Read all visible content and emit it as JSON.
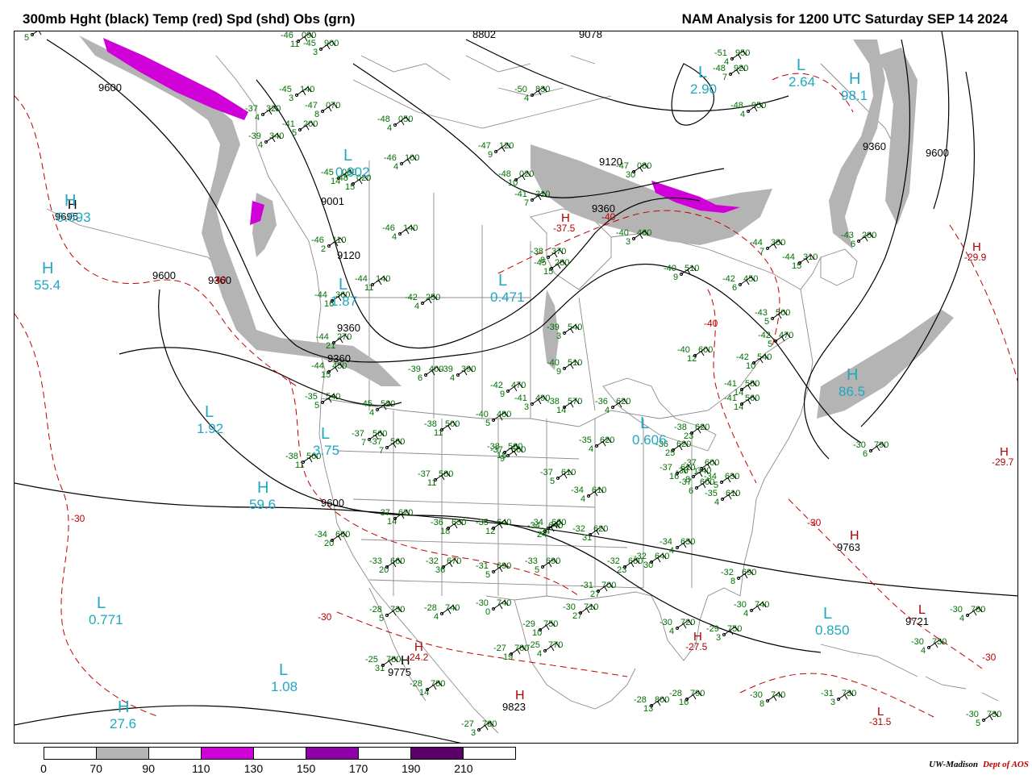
{
  "header": {
    "left_title": "300mb Hght (black) Temp (red) Spd (shd) Obs (grn)",
    "right_title": "NAM Analysis for 1200 UTC Saturday  SEP 14 2024"
  },
  "colors": {
    "height_contour": "#000000",
    "temp_contour": "#c00000",
    "obs_text": "#007000",
    "center_label": "#20a8c0",
    "temp_center": "#b00000",
    "map_lines": "#8c8c8c",
    "speed_70_90": "#b4b4b4",
    "speed_110_130": "#d000d8",
    "speed_150_170": "#9000a8",
    "speed_190_210": "#5a0068"
  },
  "height_labels": [
    "9600",
    "9360",
    "9120",
    "9600",
    "9360",
    "9600",
    "9120",
    "9360",
    "9360",
    "9600",
    "9360",
    "9078",
    "8802",
    "9001"
  ],
  "height_centers": [
    {
      "type": "H",
      "value": "9695"
    },
    {
      "type": "H",
      "value": "9775"
    },
    {
      "type": "H",
      "value": "9823"
    },
    {
      "type": "L",
      "value": "9721"
    },
    {
      "type": "H",
      "value": "9763"
    }
  ],
  "speed_centers": [
    {
      "type": "H",
      "value": "0.693"
    },
    {
      "type": "H",
      "value": "55.4"
    },
    {
      "type": "L",
      "value": "0.902"
    },
    {
      "type": "L",
      "value": "1.92"
    },
    {
      "type": "H",
      "value": "59.6"
    },
    {
      "type": "L",
      "value": "0.771"
    },
    {
      "type": "L",
      "value": "1.08"
    },
    {
      "type": "H",
      "value": "27.6"
    },
    {
      "type": "L",
      "value": "0.606"
    },
    {
      "type": "L",
      "value": "0.850"
    },
    {
      "type": "H",
      "value": "86.5"
    },
    {
      "type": "L",
      "value": "2.64"
    },
    {
      "type": "H",
      "value": "98.1"
    },
    {
      "type": "L",
      "value": "2.90"
    },
    {
      "type": "L",
      "value": "0.471"
    },
    {
      "type": "L",
      "value": "1.87"
    },
    {
      "type": "L",
      "value": "3.75"
    }
  ],
  "temp_centers": [
    {
      "type": "H",
      "value": "-37.5"
    },
    {
      "type": "H",
      "value": "-29.9"
    },
    {
      "type": "H",
      "value": "-24.2"
    },
    {
      "type": "H",
      "value": "-27.5"
    },
    {
      "type": "L",
      "value": "-31.5"
    },
    {
      "type": "H",
      "value": "-29.7"
    }
  ],
  "temp_labels": [
    "-30",
    "-30",
    "-40",
    "-40",
    "-30",
    "-30",
    "-40"
  ],
  "observations": [
    {
      "t": "-45",
      "h": "140",
      "d": "3"
    },
    {
      "t": "-47",
      "h": "070",
      "d": "8"
    },
    {
      "t": "-41",
      "h": "200",
      "d": "5"
    },
    {
      "t": "-39",
      "h": "340",
      "d": "4"
    },
    {
      "t": "-37",
      "h": "320",
      "d": "4"
    },
    {
      "t": "-48",
      "h": "050",
      "d": "4"
    },
    {
      "t": "-46",
      "h": "100",
      "d": "4"
    },
    {
      "t": "-47",
      "h": "120",
      "d": "9"
    },
    {
      "t": "-46",
      "h": "140",
      "d": "4"
    },
    {
      "t": "-41",
      "h": "310",
      "d": "7"
    },
    {
      "t": "-50",
      "h": "830",
      "d": "4"
    },
    {
      "t": "-51",
      "h": "950",
      "d": "4"
    },
    {
      "t": "-48",
      "h": "950",
      "d": "4"
    },
    {
      "t": "-43",
      "h": "280",
      "d": "6"
    },
    {
      "t": "-44",
      "h": "310",
      "d": "15"
    },
    {
      "t": "-40",
      "h": "460",
      "d": "3"
    },
    {
      "t": "-40",
      "h": "510",
      "d": "9"
    },
    {
      "t": "-42",
      "h": "450",
      "d": "6"
    },
    {
      "t": "-44",
      "h": "380",
      "d": "7"
    },
    {
      "t": "-42",
      "h": "250",
      "d": "4"
    },
    {
      "t": "-44",
      "h": "140",
      "d": "11"
    },
    {
      "t": "-38",
      "h": "370",
      "d": "8"
    },
    {
      "t": "-39",
      "h": "540",
      "d": "3"
    },
    {
      "t": "-40",
      "h": "510",
      "d": "9"
    },
    {
      "t": "-42",
      "h": "470",
      "d": "9"
    },
    {
      "t": "-41",
      "h": "490",
      "d": "3"
    },
    {
      "t": "-38",
      "h": "570",
      "d": "14"
    },
    {
      "t": "-36",
      "h": "620",
      "d": "4"
    },
    {
      "t": "-40",
      "h": "600",
      "d": "12"
    },
    {
      "t": "-38",
      "h": "620",
      "d": "23"
    },
    {
      "t": "-35",
      "h": "620",
      "d": "4"
    },
    {
      "t": "-36",
      "h": "620",
      "d": "25"
    },
    {
      "t": "-37",
      "h": "600",
      "d": "1"
    },
    {
      "t": "-34",
      "h": "630",
      "d": "5"
    },
    {
      "t": "-35",
      "h": "610",
      "d": "4"
    },
    {
      "t": "-32",
      "h": "690",
      "d": "8"
    },
    {
      "t": "-30",
      "h": "740",
      "d": "4"
    },
    {
      "t": "-29",
      "h": "750",
      "d": "3"
    },
    {
      "t": "-28",
      "h": "800",
      "d": "13"
    },
    {
      "t": "-28",
      "h": "790",
      "d": "16"
    },
    {
      "t": "-30",
      "h": "740",
      "d": "8"
    },
    {
      "t": "-31",
      "h": "730",
      "d": "3"
    },
    {
      "t": "-30",
      "h": "730",
      "d": "5"
    },
    {
      "t": "-30",
      "h": "780",
      "d": "4"
    },
    {
      "t": "-30",
      "h": "730",
      "d": "4"
    },
    {
      "t": "-30",
      "h": "790",
      "d": "6"
    },
    {
      "t": "-42",
      "h": "540",
      "d": "10"
    },
    {
      "t": "-41",
      "h": "580",
      "d": "14"
    },
    {
      "t": "-41",
      "h": "560",
      "d": "14"
    },
    {
      "t": "-42",
      "h": "470",
      "d": "5"
    },
    {
      "t": "-43",
      "h": "500",
      "d": "5"
    },
    {
      "t": "-37",
      "h": "610",
      "d": "16"
    },
    {
      "t": "-37",
      "h": "560",
      "d": "9"
    },
    {
      "t": "-38",
      "h": "580",
      "d": "18"
    },
    {
      "t": "-37",
      "h": "610",
      "d": "5"
    },
    {
      "t": "-34",
      "h": "640",
      "d": "24"
    },
    {
      "t": "-35",
      "h": "640",
      "d": "12"
    },
    {
      "t": "-34",
      "h": "660",
      "d": "24"
    },
    {
      "t": "-32",
      "h": "620",
      "d": "31"
    },
    {
      "t": "-34",
      "h": "610",
      "d": "4"
    },
    {
      "t": "-34",
      "h": "630",
      "d": "4"
    },
    {
      "t": "-32",
      "h": "640",
      "d": "30"
    },
    {
      "t": "-32",
      "h": "680",
      "d": "23"
    },
    {
      "t": "-33",
      "h": "690",
      "d": "5"
    },
    {
      "t": "-31",
      "h": "690",
      "d": "5"
    },
    {
      "t": "-32",
      "h": "670",
      "d": "36"
    },
    {
      "t": "-33",
      "h": "660",
      "d": "20"
    },
    {
      "t": "-34",
      "h": "660",
      "d": "20"
    },
    {
      "t": "-37",
      "h": "620",
      "d": "14"
    },
    {
      "t": "-36",
      "h": "630",
      "d": "18"
    },
    {
      "t": "-37",
      "h": "580",
      "d": "11"
    },
    {
      "t": "-38",
      "h": "500",
      "d": "11"
    },
    {
      "t": "-40",
      "h": "480",
      "d": "5"
    },
    {
      "t": "-37",
      "h": "560",
      "d": "7"
    },
    {
      "t": "-37",
      "h": "560",
      "d": "7"
    },
    {
      "t": "-38",
      "h": "560",
      "d": "11"
    },
    {
      "t": "-35",
      "h": "540",
      "d": "5"
    },
    {
      "t": "-45",
      "h": "520",
      "d": "4"
    },
    {
      "t": "-44",
      "h": "450",
      "d": "15"
    },
    {
      "t": "-39",
      "h": "400",
      "d": "6"
    },
    {
      "t": "-39",
      "h": "390",
      "d": "4"
    },
    {
      "t": "-44",
      "h": "360",
      "d": "16"
    },
    {
      "t": "-44",
      "h": "270",
      "d": "21"
    },
    {
      "t": "-46",
      "h": "110",
      "d": "2"
    },
    {
      "t": "-45",
      "h": "080",
      "d": "14"
    },
    {
      "t": "-48",
      "h": "020",
      "d": "15"
    },
    {
      "t": "-28",
      "h": "730",
      "d": "5"
    },
    {
      "t": "-28",
      "h": "740",
      "d": "4"
    },
    {
      "t": "-30",
      "h": "740",
      "d": "0"
    },
    {
      "t": "-29",
      "h": "750",
      "d": "10"
    },
    {
      "t": "-27",
      "h": "780",
      "d": "19"
    },
    {
      "t": "-25",
      "h": "770",
      "d": "4"
    },
    {
      "t": "-25",
      "h": "780",
      "d": "31"
    },
    {
      "t": "-28",
      "h": "780",
      "d": "14"
    },
    {
      "t": "-27",
      "h": "780",
      "d": "3"
    },
    {
      "t": "-28",
      "h": "780",
      "d": "3"
    },
    {
      "t": "-27",
      "h": "790",
      "d": "3"
    },
    {
      "t": "-30",
      "h": "710",
      "d": "27"
    },
    {
      "t": "-31",
      "h": "700",
      "d": "27"
    },
    {
      "t": "-30",
      "h": "720",
      "d": "4"
    },
    {
      "t": "-47",
      "h": "080",
      "d": "30"
    },
    {
      "t": "-48",
      "h": "020",
      "d": "10"
    },
    {
      "t": "-48",
      "h": "920",
      "d": "7"
    },
    {
      "t": "-45",
      "h": "900",
      "d": "3"
    },
    {
      "t": "-46",
      "h": "090",
      "d": "11"
    },
    {
      "t": "-45",
      "h": "280",
      "d": "15"
    },
    {
      "t": "-38",
      "h": "340",
      "d": "8"
    },
    {
      "t": "-37",
      "h": "600",
      "d": "6"
    },
    {
      "t": "-34",
      "h": "590",
      "d": "5"
    }
  ],
  "legend": {
    "ticks": [
      "0",
      "70",
      "90",
      "110",
      "130",
      "150",
      "170",
      "190",
      "210"
    ],
    "segments": [
      "#ffffff",
      "#b4b4b4",
      "#ffffff",
      "#d000d8",
      "#ffffff",
      "#9000a8",
      "#ffffff",
      "#5a0068",
      "#ffffff"
    ]
  },
  "credit": {
    "org": "UW-Madison",
    "dept": "Dept of AOS"
  }
}
